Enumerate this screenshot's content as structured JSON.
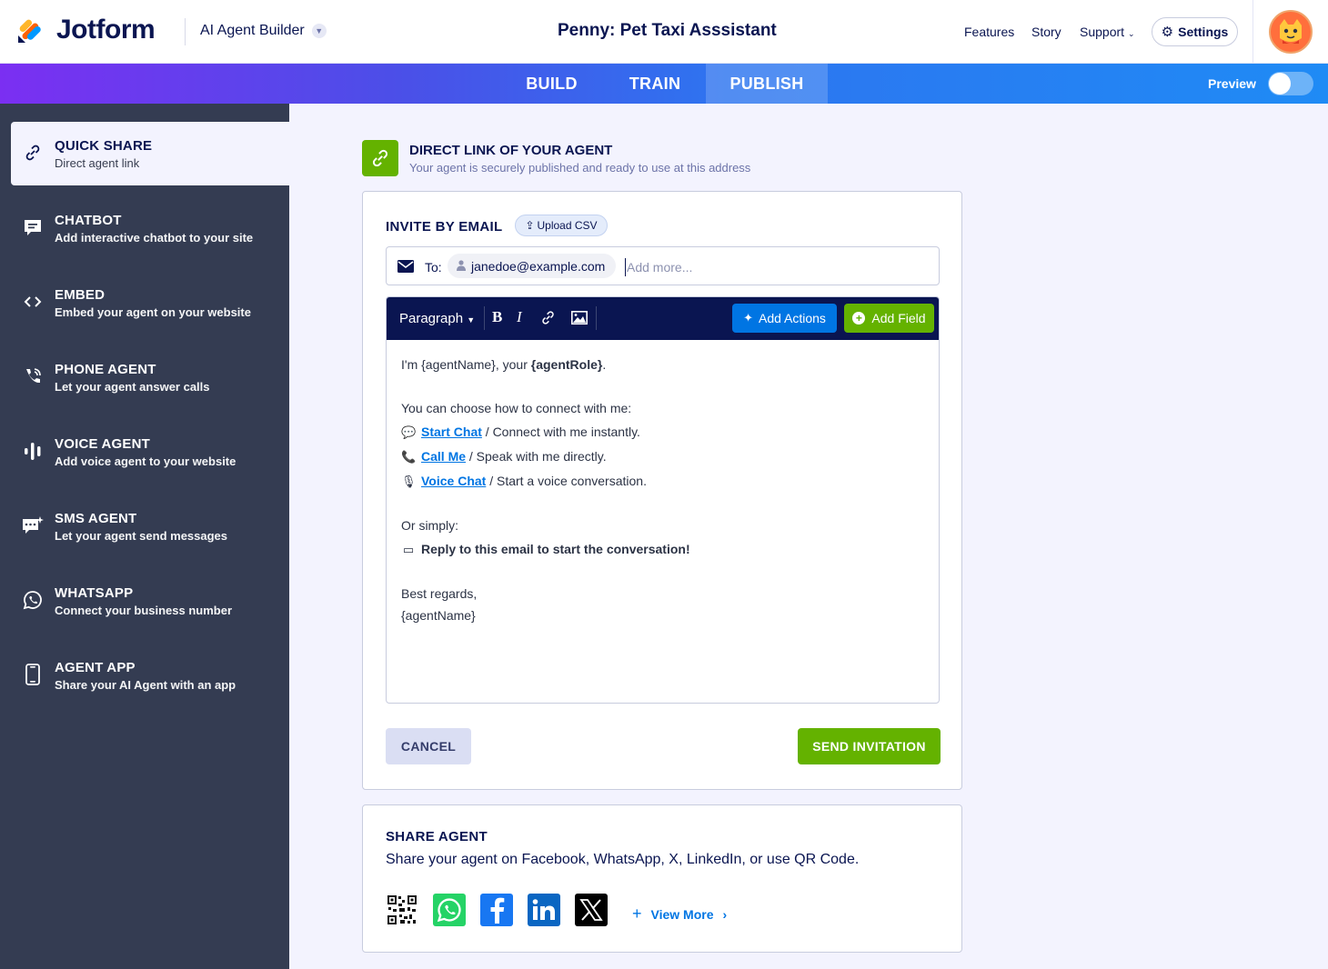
{
  "header": {
    "brand": "Jotform",
    "builder_label": "AI Agent Builder",
    "page_title": "Penny: Pet Taxi Asssistant",
    "nav": [
      "Features",
      "Story",
      "Support"
    ],
    "settings_label": "Settings"
  },
  "tabs": {
    "build": "BUILD",
    "train": "TRAIN",
    "publish": "PUBLISH",
    "active": "PUBLISH"
  },
  "preview_label": "Preview",
  "sidebar": {
    "items": [
      {
        "title": "QUICK SHARE",
        "sub": "Direct agent link",
        "icon": "link-icon"
      },
      {
        "title": "CHATBOT",
        "sub": "Add interactive chatbot to your site",
        "icon": "chat-icon"
      },
      {
        "title": "EMBED",
        "sub": "Embed your agent on your website",
        "icon": "code-icon"
      },
      {
        "title": "PHONE AGENT",
        "sub": "Let your agent answer calls",
        "icon": "phone-icon"
      },
      {
        "title": "VOICE AGENT",
        "sub": "Add voice agent to your website",
        "icon": "voice-bars-icon"
      },
      {
        "title": "SMS AGENT",
        "sub": "Let your agent send messages",
        "icon": "sms-icon"
      },
      {
        "title": "WHATSAPP",
        "sub": "Connect your business number",
        "icon": "whatsapp-icon"
      },
      {
        "title": "AGENT APP",
        "sub": "Share your AI Agent with an app",
        "icon": "mobile-app-icon"
      }
    ]
  },
  "direct_link": {
    "title": "DIRECT LINK OF YOUR AGENT",
    "subtitle": "Your agent is securely published and ready to use at this address"
  },
  "invite": {
    "title": "INVITE BY EMAIL",
    "upload_label": "Upload CSV",
    "to_label": "To:",
    "recipient": "janedoe@example.com",
    "add_more_placeholder": "Add more...",
    "toolbar": {
      "paragraph": "Paragraph",
      "bold": "B",
      "italic": "I",
      "add_actions": "Add Actions",
      "add_field": "Add Field"
    },
    "body": {
      "intro_pre": "I'm {agentName}, your ",
      "intro_role": "{agentRole}",
      "intro_post": ".",
      "choose": "You can choose how to connect with me:",
      "chat_link": "Start Chat",
      "chat_desc": " / Connect with me instantly.",
      "call_link": "Call Me",
      "call_desc": " / Speak with me directly.",
      "voice_link": "Voice Chat",
      "voice_desc": " / Start a voice conversation.",
      "or_simply": "Or simply:",
      "reply": "Reply to this email to start the conversation!",
      "regards": "Best regards,",
      "signature": "{agentName}"
    },
    "cancel_label": "CANCEL",
    "send_label": "SEND INVITATION"
  },
  "share": {
    "title": "SHARE AGENT",
    "subtitle": "Share your agent on Facebook, WhatsApp, X, LinkedIn, or use QR Code.",
    "view_more": "View More",
    "icons": [
      "qr-code-icon",
      "whatsapp-icon",
      "facebook-icon",
      "linkedin-icon",
      "x-icon"
    ]
  },
  "colors": {
    "navy": "#0a1551",
    "sidebar": "#343c52",
    "green": "#64b200",
    "blue": "#0075e3"
  }
}
